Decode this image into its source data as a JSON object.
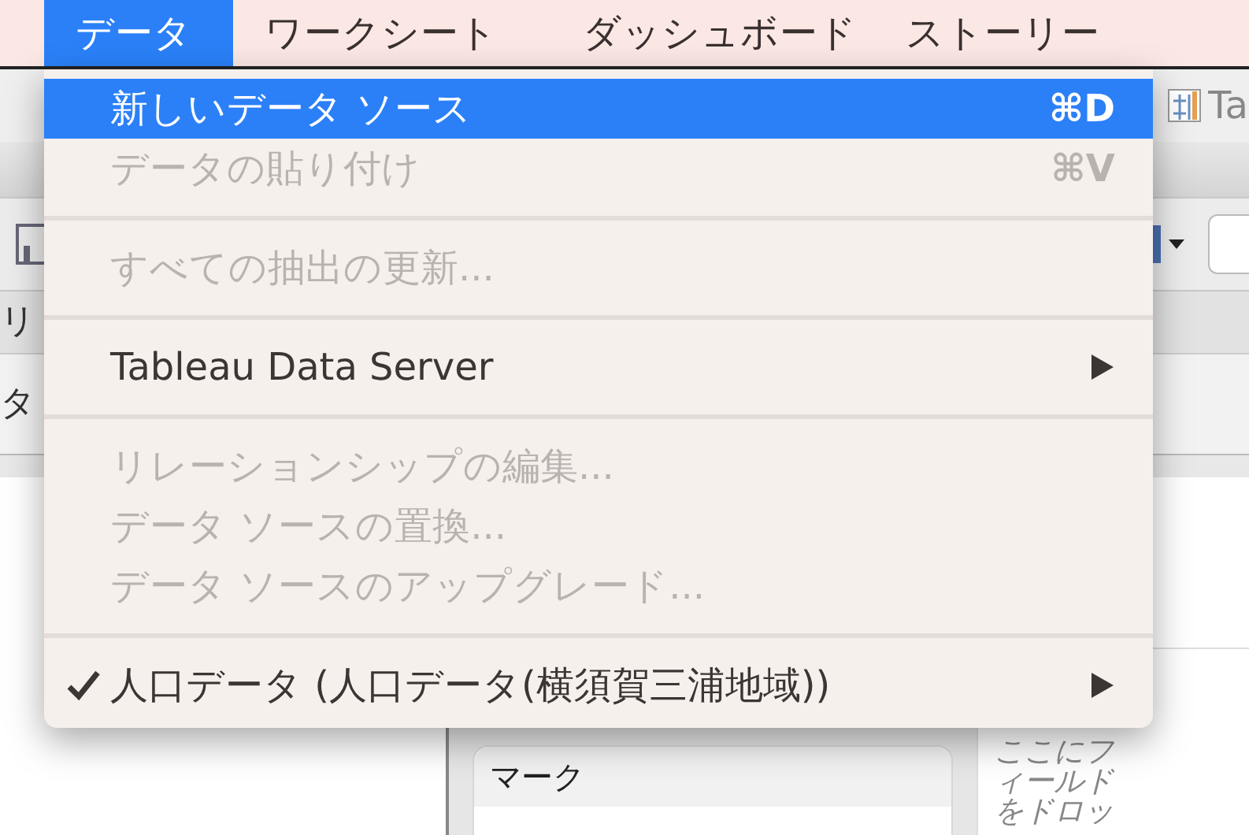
{
  "menubar": {
    "items": [
      {
        "label": "データ",
        "selected": true
      },
      {
        "label": "ワークシート",
        "selected": false
      },
      {
        "label": "ダッシュボード",
        "selected": false
      },
      {
        "label": "ストーリー",
        "selected": false
      }
    ]
  },
  "menu": {
    "items": [
      {
        "kind": "item",
        "label": "新しいデータ ソース",
        "shortcut": "⌘D",
        "selected": true,
        "disabled": false,
        "checked": false,
        "submenu": false
      },
      {
        "kind": "item",
        "label": "データの貼り付け",
        "shortcut": "⌘V",
        "selected": false,
        "disabled": true,
        "checked": false,
        "submenu": false
      },
      {
        "kind": "separator"
      },
      {
        "kind": "item",
        "label": "すべての抽出の更新...",
        "selected": false,
        "disabled": true,
        "checked": false,
        "submenu": false
      },
      {
        "kind": "separator"
      },
      {
        "kind": "item",
        "label": "Tableau Data Server",
        "selected": false,
        "disabled": false,
        "checked": false,
        "submenu": true
      },
      {
        "kind": "separator"
      },
      {
        "kind": "item",
        "label": "リレーションシップの編集...",
        "selected": false,
        "disabled": true,
        "checked": false,
        "submenu": false
      },
      {
        "kind": "item",
        "label": "データ ソースの置換...",
        "selected": false,
        "disabled": true,
        "checked": false,
        "submenu": false
      },
      {
        "kind": "item",
        "label": "データ ソースのアップグレード...",
        "selected": false,
        "disabled": true,
        "checked": false,
        "submenu": false
      },
      {
        "kind": "separator"
      },
      {
        "kind": "item",
        "label": "人口データ (人口データ(横須賀三浦地域))",
        "selected": false,
        "disabled": false,
        "checked": true,
        "submenu": true
      }
    ]
  },
  "background": {
    "tab_label": "Ta",
    "left_rows": [
      "リ",
      "タ"
    ],
    "marks_card": {
      "title": "マーク"
    },
    "drop_hint": "ここにフィールドをドロッ"
  }
}
